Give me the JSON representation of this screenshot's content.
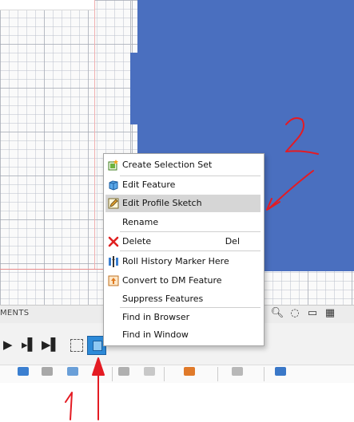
{
  "browser_bar": {
    "label": "MENTS"
  },
  "context_menu": {
    "items": [
      {
        "label": "Create Selection Set",
        "icon": "selection-set-icon"
      },
      {
        "label": "Edit Feature",
        "icon": "edit-feature-icon"
      },
      {
        "label": "Edit Profile Sketch",
        "icon": "edit-sketch-icon",
        "highlighted": true
      },
      {
        "label": "Rename",
        "icon": ""
      },
      {
        "label": "Delete",
        "icon": "delete-x-icon",
        "shortcut": "Del"
      },
      {
        "label": "Roll History Marker Here",
        "icon": "roll-history-icon"
      },
      {
        "label": "Convert to DM Feature",
        "icon": "convert-dm-icon"
      },
      {
        "label": "Suppress Features",
        "icon": ""
      },
      {
        "label": "Find in Browser",
        "icon": ""
      },
      {
        "label": "Find in Window",
        "icon": ""
      }
    ]
  },
  "annotations": {
    "one": "1",
    "two": "2"
  },
  "colors": {
    "body": "#4a6fbf",
    "annotation": "#e41b23",
    "highlight": "#d6d6d6"
  }
}
